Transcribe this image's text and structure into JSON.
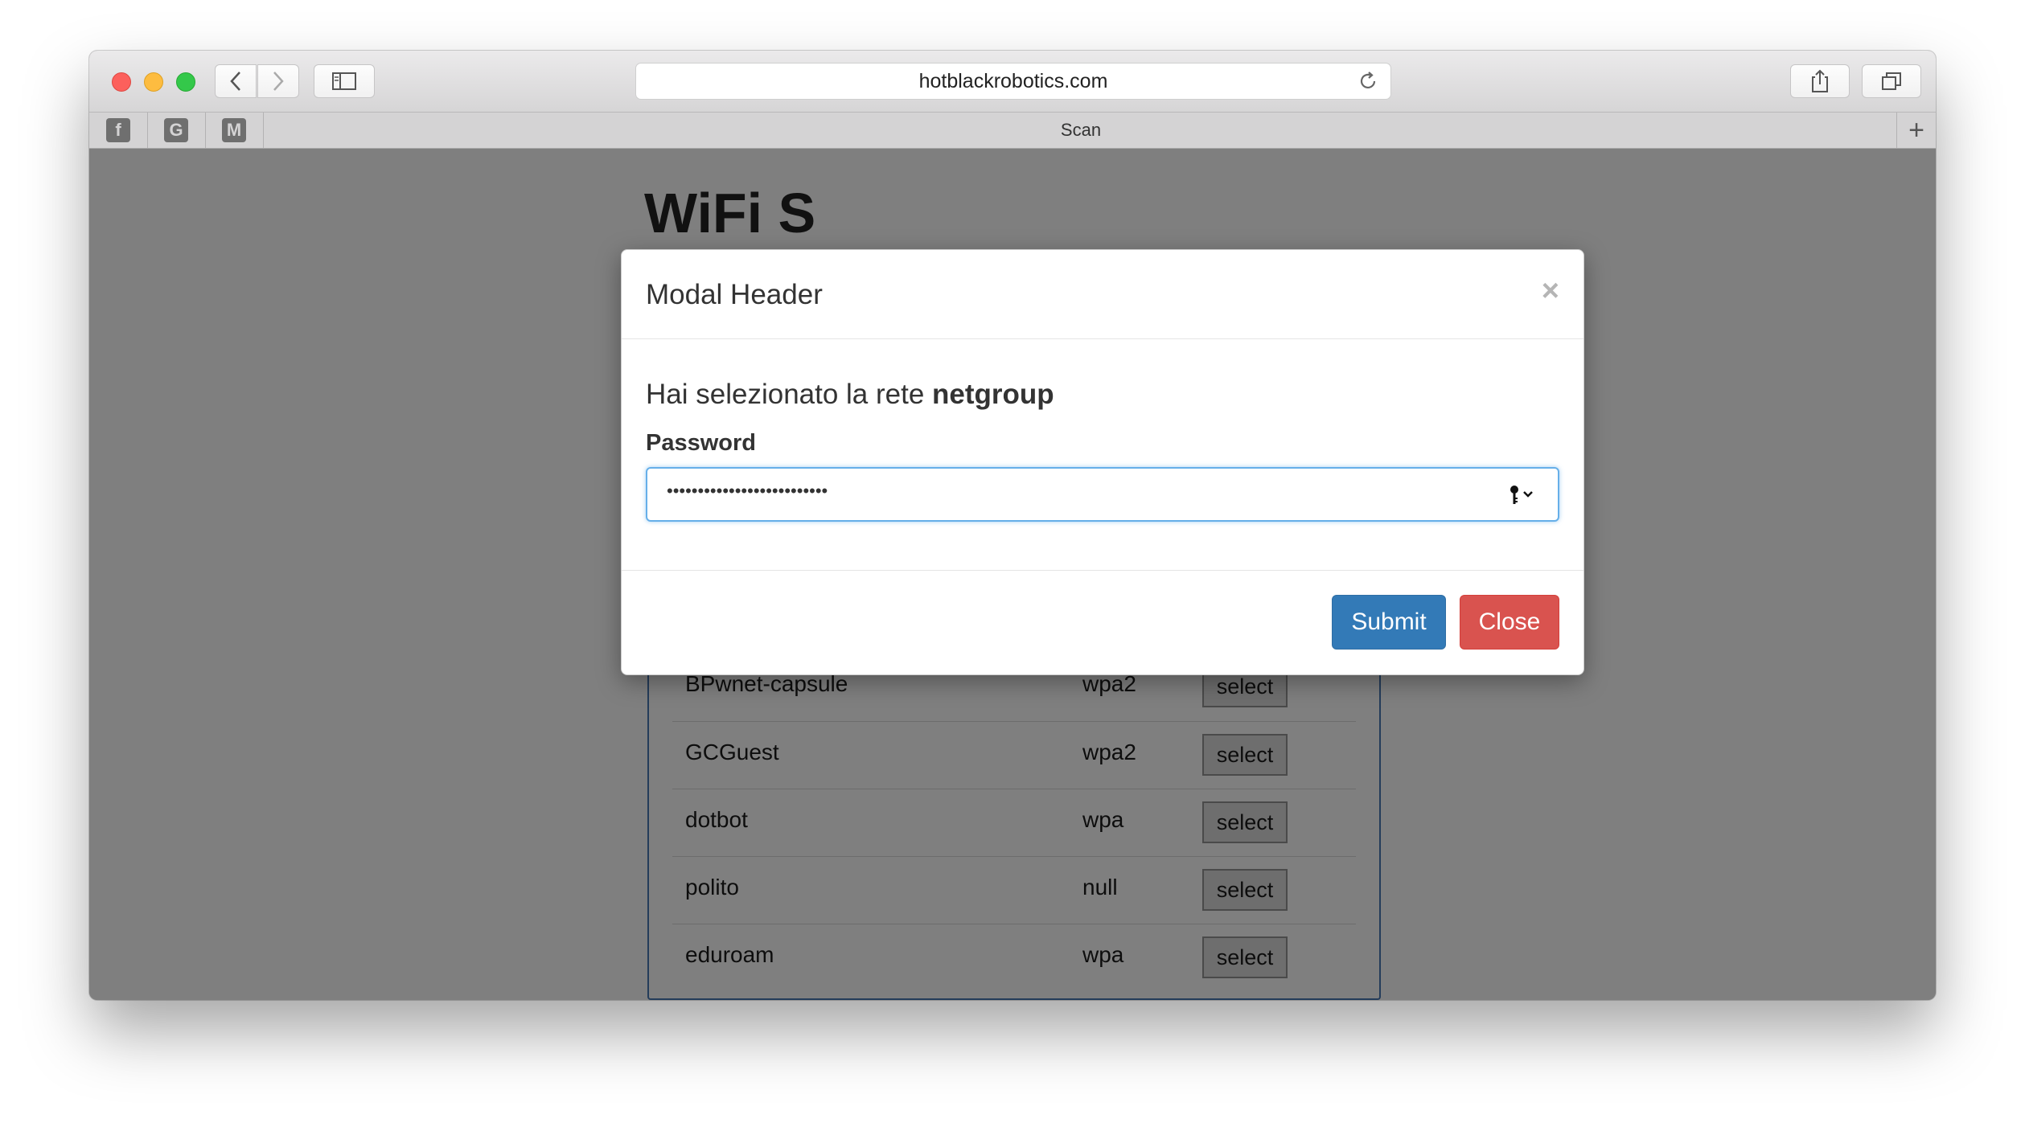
{
  "browser": {
    "url": "hotblackrobotics.com",
    "tab_title": "Scan",
    "favorites": [
      "G",
      "M"
    ]
  },
  "page": {
    "heading": "WiFi S",
    "networks": [
      {
        "name": "BPwnet-capsule",
        "security": "wpa2",
        "action": "select"
      },
      {
        "name": "GCGuest",
        "security": "wpa2",
        "action": "select"
      },
      {
        "name": "dotbot",
        "security": "wpa",
        "action": "select"
      },
      {
        "name": "polito",
        "security": "null",
        "action": "select"
      },
      {
        "name": "eduroam",
        "security": "wpa",
        "action": "select"
      }
    ]
  },
  "modal": {
    "title": "Modal Header",
    "close_symbol": "×",
    "message_prefix": "Hai selezionato la rete",
    "network": "netgroup",
    "password_label": "Password",
    "password_mask": "••••••••••••••••••••••••••",
    "submit_label": "Submit",
    "close_label": "Close"
  },
  "colors": {
    "submit": "#337ab7",
    "close": "#d9534f",
    "focus": "#66afe9"
  }
}
